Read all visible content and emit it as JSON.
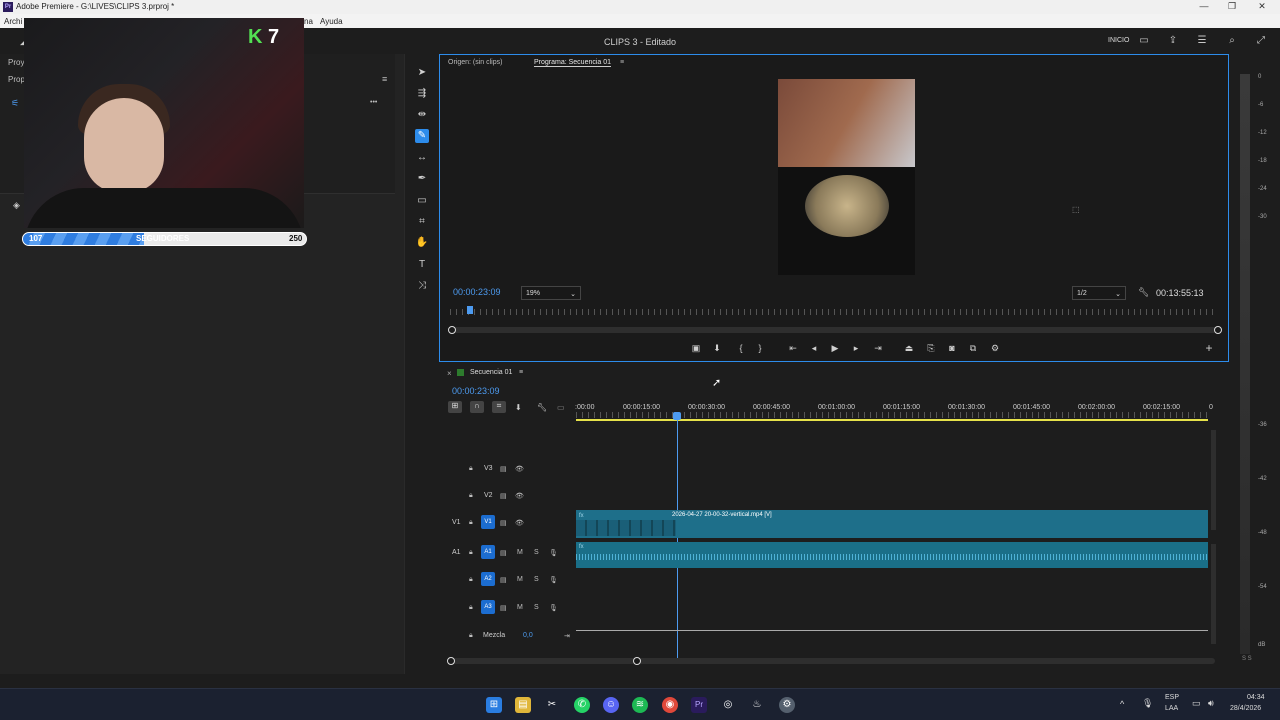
{
  "window": {
    "title": "Adobe Premiere - G:\\LIVES\\CLIPS 3.prproj *",
    "app_icon": "Pr",
    "controls": [
      "—",
      "❐",
      "✕"
    ]
  },
  "menu": {
    "items": [
      "Archi",
      "na",
      "Ayuda"
    ]
  },
  "header": {
    "project_title": "CLIPS 3 - Editado",
    "inicio": "INICIO"
  },
  "left": {
    "proj_label": "Proye",
    "props_label": "Propi",
    "panel_menu": "≡",
    "dots": "•••"
  },
  "overlay": {
    "k_prefix": "K",
    "k_count": "7",
    "followers": {
      "current": "107",
      "label": "SEGUIDORES",
      "goal": "250",
      "progress": 0.428
    }
  },
  "monitor": {
    "tab_source": "Origen: (sin clips)",
    "tab_program": "Programa: Secuencia 01",
    "tab_menu": "≡",
    "timecode": "00:00:23:09",
    "zoom": "19%",
    "resolution": "1/2",
    "duration": "00:13:55:13",
    "add": "+"
  },
  "timeline": {
    "sequence_name": "Secuencia 01",
    "close": "×",
    "menu": "≡",
    "timecode": "00:00:23:09",
    "ruler": [
      ":00:00",
      "00:00:15:00",
      "00:00:30:00",
      "00:00:45:00",
      "00:01:00:00",
      "00:01:15:00",
      "00:01:30:00",
      "00:01:45:00",
      "00:02:00:00",
      "00:02:15:00",
      "0"
    ],
    "tracks": {
      "v3": "V3",
      "v2": "V2",
      "v1": "V1",
      "v1_src": "V1",
      "a1": "A1",
      "a1_src": "A1",
      "a2": "A2",
      "a3": "A3",
      "m": "M",
      "s": "S",
      "mix": "Mezcla",
      "mix_val": "0,0"
    },
    "clip_name": "2026-04-27 20-00-32-vertical.mp4 [V]",
    "fx": "fx"
  },
  "meter": {
    "labels": [
      "0",
      "-6",
      "-12",
      "-18",
      "-24",
      "-30",
      "-36",
      "-42",
      "-48",
      "-54",
      "dB"
    ],
    "bottom": "S S"
  },
  "taskbar": {
    "lang": "ESP",
    "lang2": "LAA",
    "time": "04:34",
    "date": "28/4/2026",
    "caret": "^"
  }
}
